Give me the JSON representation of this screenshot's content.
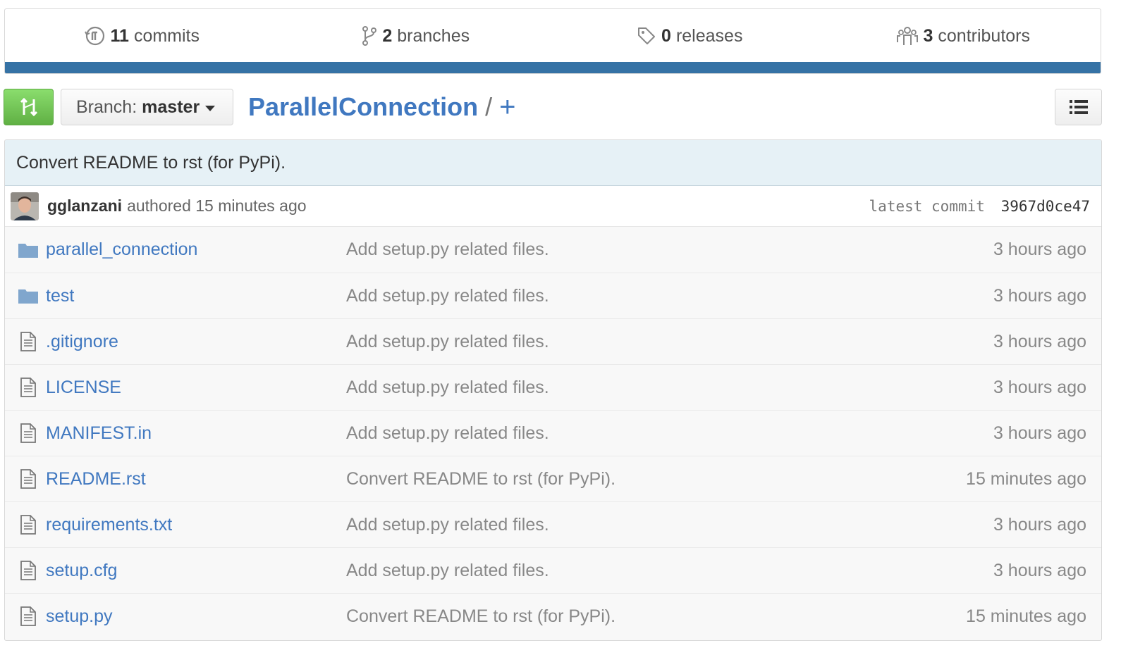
{
  "summary": {
    "commits": {
      "num": "11",
      "label": "commits",
      "icon": "history-icon"
    },
    "branches": {
      "num": "2",
      "label": "branches",
      "icon": "branch-icon"
    },
    "releases": {
      "num": "0",
      "label": "releases",
      "icon": "tag-icon"
    },
    "contributors": {
      "num": "3",
      "label": "contributors",
      "icon": "people-icon"
    },
    "language_color": "#3572a5"
  },
  "toolbar": {
    "branch_prefix": "Branch:",
    "branch_name": "master",
    "repo_name": "ParallelConnection",
    "separator": "/",
    "add_file": "+"
  },
  "commit": {
    "message": "Convert README to rst (for PyPi).",
    "author": "gglanzani",
    "authored_text": "authored 15 minutes ago",
    "latest_label": "latest commit",
    "sha": "3967d0ce47"
  },
  "files": [
    {
      "type": "directory",
      "name": "parallel_connection",
      "message": "Add setup.py related files.",
      "age": "3 hours ago"
    },
    {
      "type": "directory",
      "name": "test",
      "message": "Add setup.py related files.",
      "age": "3 hours ago"
    },
    {
      "type": "file",
      "name": ".gitignore",
      "message": "Add setup.py related files.",
      "age": "3 hours ago"
    },
    {
      "type": "file",
      "name": "LICENSE",
      "message": "Add setup.py related files.",
      "age": "3 hours ago"
    },
    {
      "type": "file",
      "name": "MANIFEST.in",
      "message": "Add setup.py related files.",
      "age": "3 hours ago"
    },
    {
      "type": "file",
      "name": "README.rst",
      "message": "Convert README to rst (for PyPi).",
      "age": "15 minutes ago"
    },
    {
      "type": "file",
      "name": "requirements.txt",
      "message": "Add setup.py related files.",
      "age": "3 hours ago"
    },
    {
      "type": "file",
      "name": "setup.cfg",
      "message": "Add setup.py related files.",
      "age": "3 hours ago"
    },
    {
      "type": "file",
      "name": "setup.py",
      "message": "Convert README to rst (for PyPi).",
      "age": "15 minutes ago"
    }
  ]
}
